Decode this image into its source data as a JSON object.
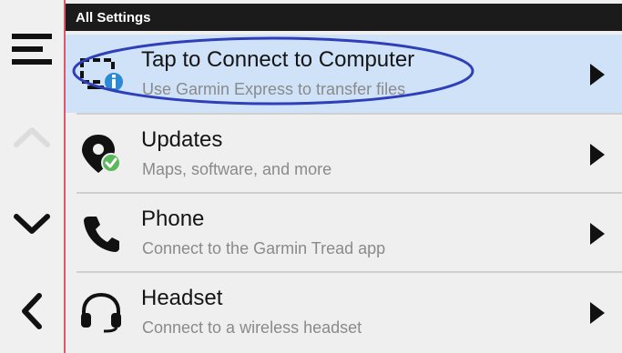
{
  "header": {
    "title": "All Settings"
  },
  "sidebar": {
    "icons": [
      "menu-icon",
      "chevron-up-icon",
      "chevron-down-icon",
      "chevron-left-icon"
    ]
  },
  "items": [
    {
      "title": "Tap to Connect to Computer",
      "subtitle": "Use Garmin Express to transfer files",
      "icon": "computer-info-icon",
      "selected": true
    },
    {
      "title": "Updates",
      "subtitle": "Maps, software, and more",
      "icon": "map-pin-check-icon",
      "selected": false
    },
    {
      "title": "Phone",
      "subtitle": "Connect to the Garmin Tread app",
      "icon": "phone-icon",
      "selected": false
    },
    {
      "title": "Headset",
      "subtitle": "Connect to a wireless headset",
      "icon": "headset-icon",
      "selected": false
    }
  ],
  "colors": {
    "selected_row": "#cfe2f8",
    "header_bg": "#1b1b1b",
    "annotation_ellipse": "#2f3fb8",
    "check_badge": "#5cb85c",
    "info_badge": "#2a8ad6"
  }
}
